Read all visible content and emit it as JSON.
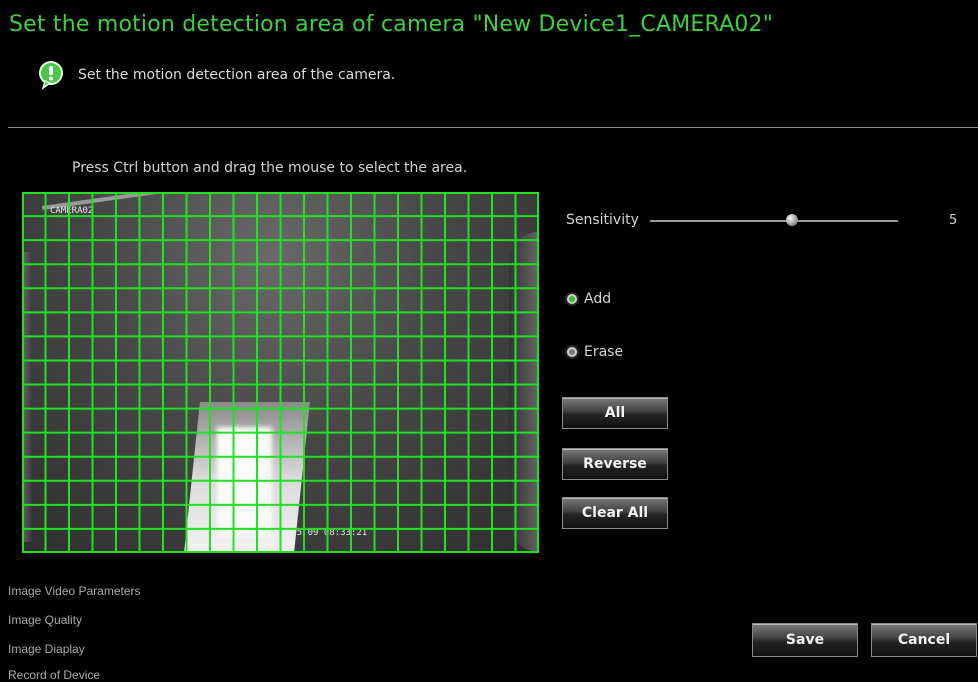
{
  "header": {
    "title": "Set the motion detection area of camera \"New Device1_CAMERA02\"",
    "subtitle": "Set the motion detection area of the camera."
  },
  "instruction": "Press Ctrl button and drag the mouse to select the area.",
  "video": {
    "osd_camera": "CAMERA02",
    "osd_time": "11 2017 05 09 08:33:21",
    "grid": {
      "columns": 22,
      "rows": 15,
      "line_color": "#22e022"
    }
  },
  "sensitivity": {
    "label": "Sensitivity",
    "value": "5",
    "min": 1,
    "max": 8
  },
  "mode": {
    "add_label": "Add",
    "erase_label": "Erase",
    "selected": "add"
  },
  "buttons": {
    "all": "All",
    "reverse": "Reverse",
    "clear_all": "Clear All",
    "save": "Save",
    "cancel": "Cancel"
  },
  "bottom_menu": [
    "Image Video Parameters",
    "Image Quality",
    "Image Diaplay",
    "Record of Device"
  ],
  "colors": {
    "title_green": "#3fcf3f",
    "accent_green": "#2fbf2f",
    "background": "#000000"
  },
  "icons": {
    "info": "speech-bubble-info-icon",
    "slider_thumb": "slider-thumb-icon"
  }
}
